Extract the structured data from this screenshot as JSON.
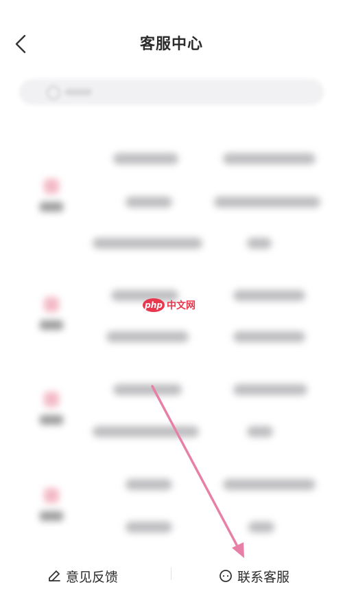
{
  "header": {
    "title": "客服中心",
    "back_icon": "chevron-left-icon"
  },
  "watermark": {
    "logo_text": "php",
    "site_text": "中文网"
  },
  "bottom_bar": {
    "feedback_label": "意见反馈",
    "feedback_icon": "pencil-icon",
    "contact_label": "联系客服",
    "contact_icon": "chat-bubble-icon"
  },
  "colors": {
    "annotation_arrow": "#e87fa6",
    "watermark_red": "#e8374d",
    "category_icon_pink": "#f3b9c6"
  }
}
